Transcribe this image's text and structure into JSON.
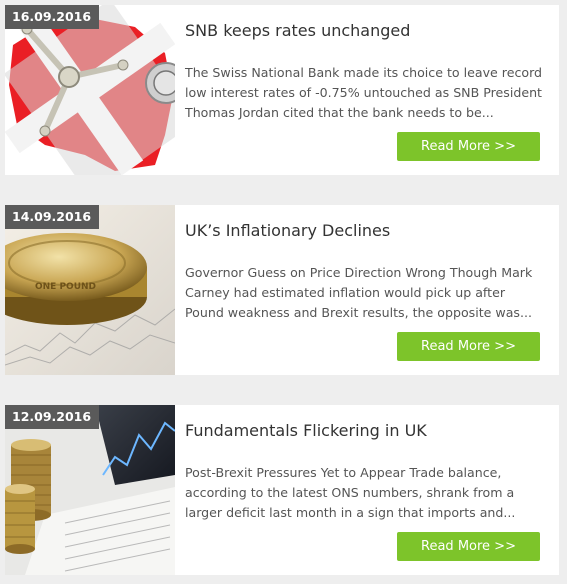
{
  "articles": [
    {
      "date": "16.09.2016",
      "title": "SNB keeps rates unchanged",
      "excerpt": "The Swiss National Bank made its choice to leave record low interest rates of -0.75% untouched as SNB President Thomas Jordan cited that the bank needs to be...",
      "button": "Read More >>",
      "image": "swiss-flag-safe-image"
    },
    {
      "date": "14.09.2016",
      "title": "UK’s Inflationary Declines",
      "excerpt": "Governor Guess on Price Direction Wrong Though Mark Carney had estimated inflation would pick up after Pound weakness and Brexit results, the opposite was...",
      "button": "Read More >>",
      "image": "pound-coin-image"
    },
    {
      "date": "12.09.2016",
      "title": "Fundamentals Flickering in UK",
      "excerpt": "Post-Brexit Pressures Yet to Appear Trade balance, according to the latest ONS numbers, shrank from a larger deficit last month in a sign that imports and...",
      "button": "Read More >>",
      "image": "coin-stack-chart-image"
    }
  ],
  "colors": {
    "button": "#7dc42a",
    "date_badge": "#5a5a5a",
    "background": "#eeeeee"
  }
}
